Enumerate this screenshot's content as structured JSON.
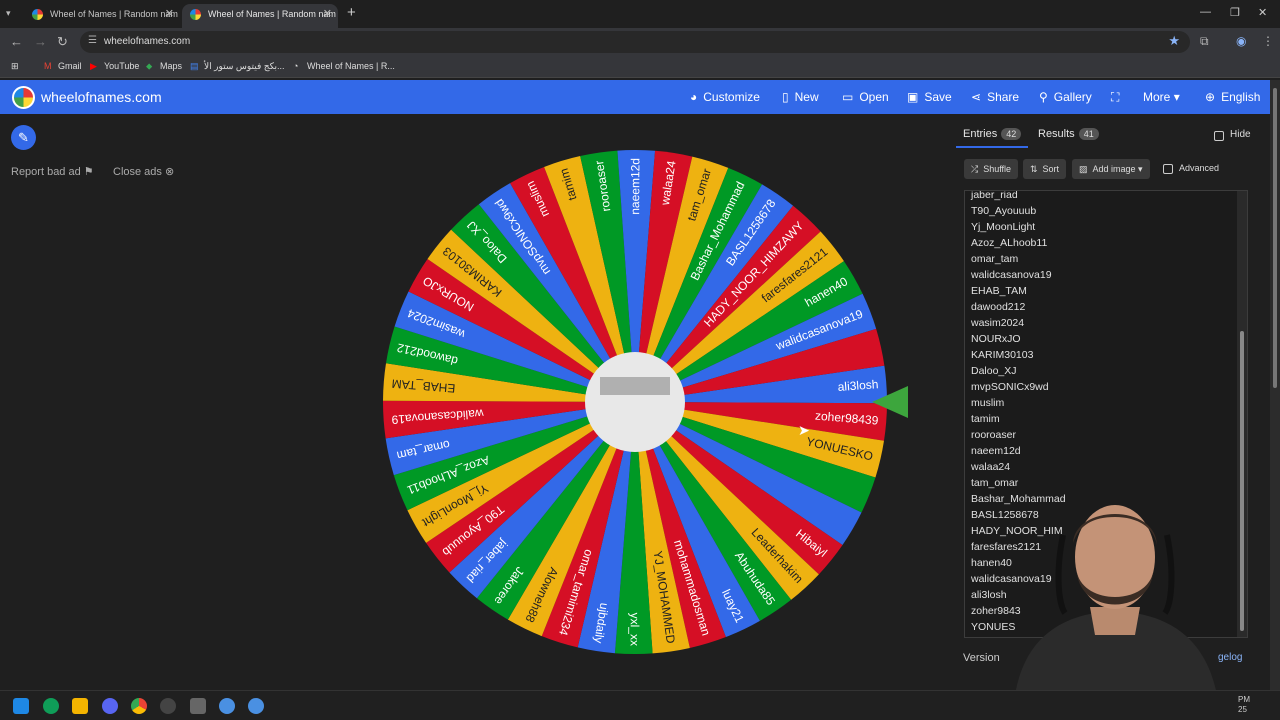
{
  "browser": {
    "tabs": [
      {
        "title": "Wheel of Names | Random nam",
        "active": false
      },
      {
        "title": "Wheel of Names | Random nam",
        "active": true
      }
    ],
    "url": "wheelofnames.com",
    "bookmarks": [
      "Gmail",
      "YouTube",
      "Maps",
      "بكج فيتوس ستور الأ...",
      "Wheel of Names | R..."
    ]
  },
  "header": {
    "site_name": "wheelofnames.com",
    "menu": [
      "Customize",
      "New",
      "Open",
      "Save",
      "Share",
      "Gallery",
      "More",
      "English"
    ]
  },
  "left": {
    "report_ad": "Report bad ad",
    "close_ads": "Close ads"
  },
  "panel": {
    "entries_label": "Entries",
    "entries_count": "42",
    "results_label": "Results",
    "results_count": "41",
    "hide_label": "Hide",
    "shuffle_label": "Shuffle",
    "sort_label": "Sort",
    "add_image_label": "Add image",
    "advanced_label": "Advanced",
    "version_label": "Version",
    "changelog_label": "gelog",
    "entries": [
      "jaber_riad",
      "T90_Ayouuub",
      "Yj_MoonLight",
      "Azoz_ALhoob11",
      "omar_tam",
      "walidcasanova19",
      "EHAB_TAM",
      "dawood212",
      "wasim2024",
      "NOURxJO",
      "KARIM30103",
      "Daloo_XJ",
      "mvpSONICx9wd",
      "muslim",
      "tamim",
      "rooroaser",
      "naeem12d",
      "walaa24",
      "tam_omar",
      "Bashar_Mohammad",
      "BASL1258678",
      "HADY_NOOR_HIM",
      "faresfares2121",
      "hanen40",
      "walidcasanova19",
      "ali3losh",
      "zoher9843",
      "YONUES"
    ]
  },
  "wheel": {
    "colors": [
      "#3369e8",
      "#d50f25",
      "#eeb211",
      "#009925"
    ],
    "segments": [
      "ali3losh",
      "zoher98439",
      "YONUESKO",
      "",
      "",
      "Hibaiyl",
      "Leaderhakim",
      "Abuhuda85",
      "luay21",
      "mohammadosman",
      "YJ_MOHAMMED",
      "yxl_xx",
      "ujbdaily",
      "omar_tamimi234",
      "Alowneh88",
      "Jakoree",
      "jaber_riad",
      "T90_Ayouuub",
      "Yj_MoonLight",
      "Azoz_ALhoob11",
      "omar_tam",
      "walidcasanova19",
      "EHAB_TAM",
      "dawood212",
      "wasim2024",
      "NOURxJO",
      "KARIM30103",
      "Daloo_XJ",
      "mvpSONICx9wd",
      "muslim",
      "tamim",
      "rooroaser",
      "naeem12d",
      "walaa24",
      "tam_omar",
      "Bashar_Mohammad",
      "BASL1258678",
      "HADY_NOOR_HIMZAWY",
      "faresfares2121",
      "hanen40",
      "walidcasanova19",
      ""
    ],
    "pointer_color": "#3da63d"
  },
  "taskbar": {
    "time_top": "PM",
    "time_bottom": "25"
  }
}
